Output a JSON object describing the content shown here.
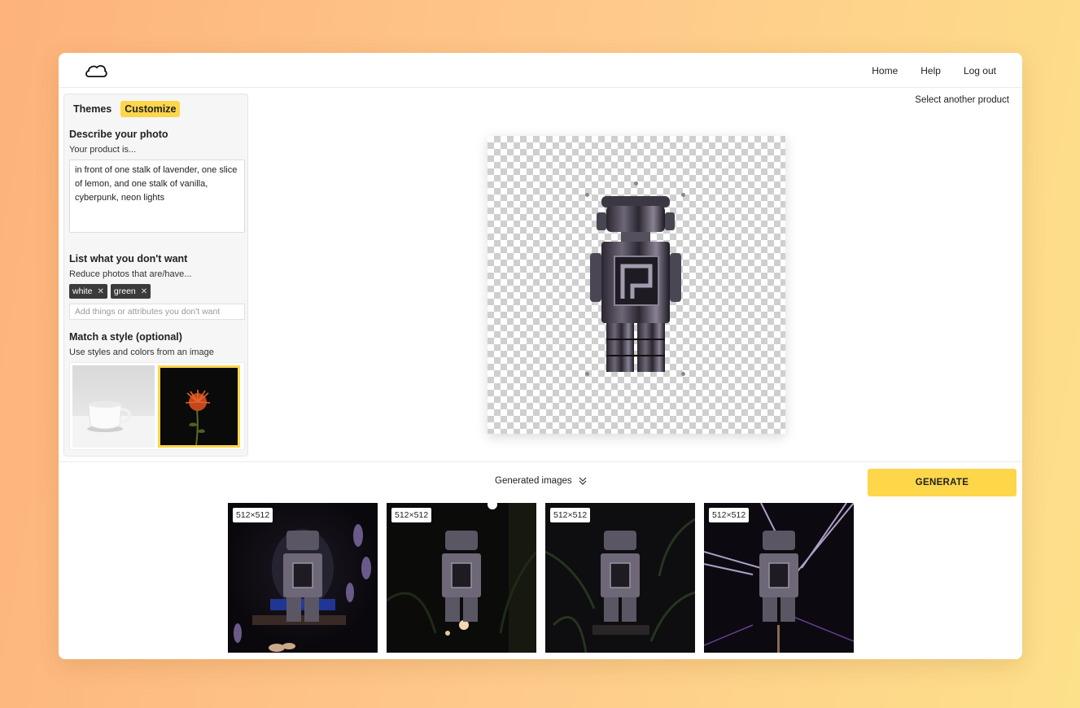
{
  "nav": {
    "home": "Home",
    "help": "Help",
    "logout": "Log out"
  },
  "sidebar": {
    "tabs": [
      {
        "label": "Themes"
      },
      {
        "label": "Customize"
      }
    ],
    "describe": {
      "title": "Describe your photo",
      "subtitle": "Your product is...",
      "value": "in front of one stalk of lavender, one slice of lemon, and one stalk of vanilla, cyberpunk, neon lights"
    },
    "exclude": {
      "title": "List what you don't want",
      "subtitle": "Reduce photos that are/have...",
      "chips": [
        {
          "label": "white"
        },
        {
          "label": "green"
        }
      ],
      "placeholder": "Add things or attributes you don't want"
    },
    "style": {
      "title": "Match a style (optional)",
      "subtitle": "Use styles and colors from an image"
    }
  },
  "main": {
    "select_another": "Select another product"
  },
  "generated": {
    "label": "Generated images",
    "button": "GENERATE",
    "results": [
      {
        "size": "512×512"
      },
      {
        "size": "512×512"
      },
      {
        "size": "512×512"
      },
      {
        "size": "512×512"
      }
    ]
  },
  "colors": {
    "accent": "#fdd64a",
    "chip": "#3b3b3b"
  },
  "icons": {
    "logo": "cloud-logo-icon",
    "chevron": "double-chevron-down-icon",
    "remove": "close-icon"
  }
}
